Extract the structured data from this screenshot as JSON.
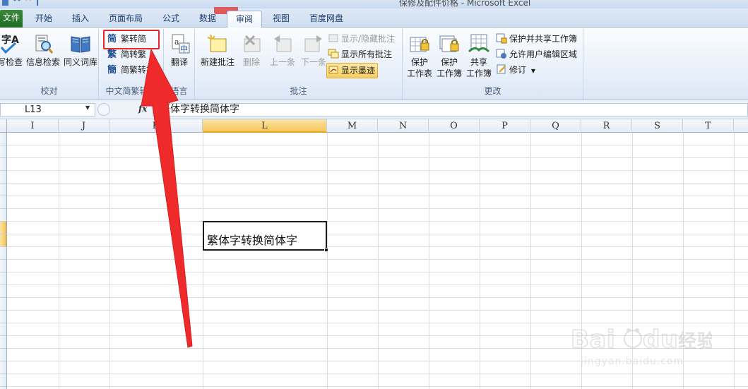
{
  "window": {
    "title": "保修及配件价格 - Microsoft Excel"
  },
  "tabs": [
    {
      "label": "文件"
    },
    {
      "label": "开始"
    },
    {
      "label": "插入"
    },
    {
      "label": "页面布局"
    },
    {
      "label": "公式"
    },
    {
      "label": "数据"
    },
    {
      "label": "审阅"
    },
    {
      "label": "视图"
    },
    {
      "label": "百度网盘"
    }
  ],
  "ribbon": {
    "proofing": {
      "group_label": "校对",
      "spellcheck_label": "拼写检查",
      "research_label": "信息检索",
      "thesaurus_label": "同义词库"
    },
    "chinese_conversion": {
      "group_label": "中文简繁转换",
      "trad_to_simp": "繁转简",
      "simp_to_trad": "简转繁",
      "convert": "简繁转换"
    },
    "language": {
      "group_label": "语言",
      "translate_label": "翻译"
    },
    "comments": {
      "group_label": "批注",
      "new_comment": "新建批注",
      "delete": "删除",
      "previous": "上一条",
      "next": "下一条",
      "show_hide_comment": "显示/隐藏批注",
      "show_all_comments": "显示所有批注",
      "show_ink": "显示墨迹"
    },
    "changes": {
      "group_label": "更改",
      "protect_sheet": "保护\n工作表",
      "protect_sheet_l1": "保护",
      "protect_sheet_l2": "工作表",
      "protect_workbook_l1": "保护",
      "protect_workbook_l2": "工作簿",
      "share_workbook_l1": "共享",
      "share_workbook_l2": "工作簿",
      "protect_and_share": "保护并共享工作簿",
      "allow_edit_ranges": "允许用户编辑区域",
      "track_changes": "修订"
    }
  },
  "formula_bar": {
    "name_box": "L13",
    "fx": "fx",
    "content": "繁体字转换简体字"
  },
  "columns": [
    "I",
    "J",
    "K",
    "L",
    "M",
    "N",
    "O",
    "P",
    "Q",
    "R",
    "S",
    "T"
  ],
  "selected_column": "L",
  "active_cell": {
    "ref": "L13",
    "value": "繁体字转换简体字"
  },
  "watermark": {
    "logo": "Bai du 经验",
    "url": "jingyan.baidu.com"
  },
  "colors": {
    "file_tab": "#1f6b25",
    "highlight_red": "#e8262b",
    "selection_header": "#f5c85a",
    "ribbon_bg": "#e6eef9"
  }
}
